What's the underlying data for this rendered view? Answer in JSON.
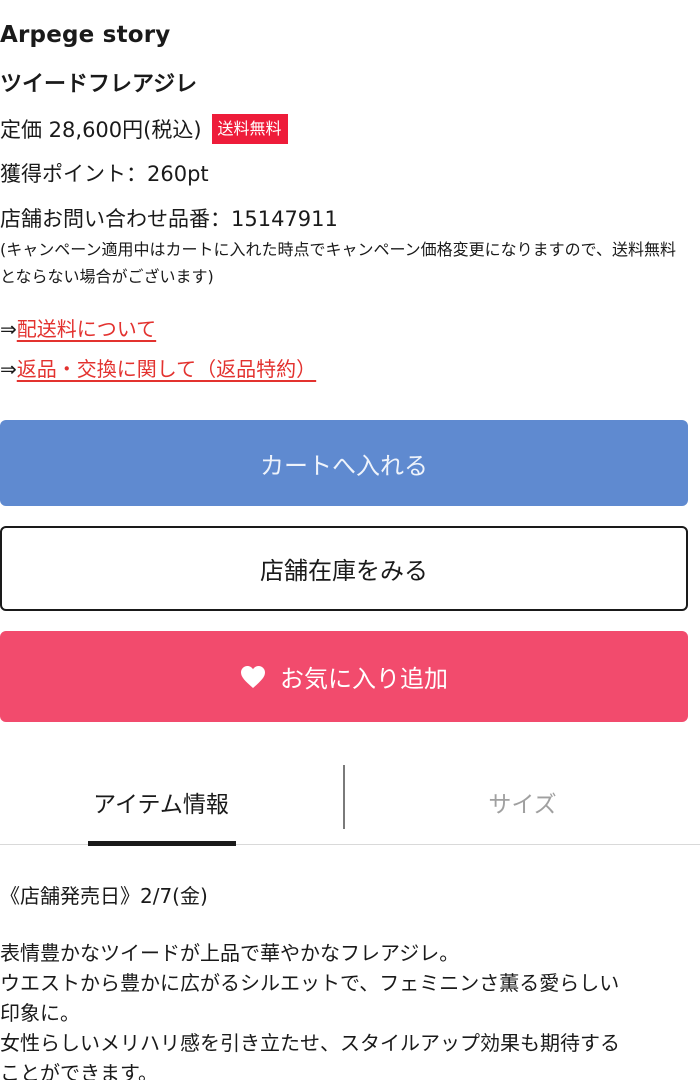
{
  "product": {
    "brand": "Arpege story",
    "name": "ツイードフレアジレ",
    "price_text": "定価 28,600円(税込)",
    "free_shipping_badge": "送料無料",
    "points_text": "獲得ポイント：260pt",
    "item_number_text": "店舗お問い合わせ品番：15147911",
    "campaign_note": "(キャンペーン適用中はカートに入れた時点でキャンペーン価格変更になりますので、送料無料とならない場合がございます)"
  },
  "links": {
    "arrow": "⇒",
    "shipping": "配送料について",
    "returns": "返品・交換に関して（返品特約）"
  },
  "buttons": {
    "add_to_cart": "カートへ入れる",
    "store_stock": "店舗在庫をみる",
    "add_favorite": "お気に入り追加"
  },
  "tabs": [
    {
      "label": "アイテム情報",
      "active": true
    },
    {
      "label": "サイズ",
      "active": false
    }
  ],
  "details": {
    "release_date": "《店舗発売日》2/7(金)",
    "description_lines": [
      "表情豊かなツイードが上品で華やかなフレアジレ。",
      "ウエストから豊かに広がるシルエットで、フェミニンさ薫る愛らしい",
      "印象に。",
      "女性らしいメリハリ感を引き立たせ、スタイルアップ効果も期待する",
      "ことができます。"
    ]
  },
  "colors": {
    "cart_button": "#5f8ad0",
    "favorite_button": "#f24b6d",
    "badge": "#ee1c3a",
    "link": "#e3322f"
  },
  "icons": {
    "favorite": "heart-icon"
  }
}
